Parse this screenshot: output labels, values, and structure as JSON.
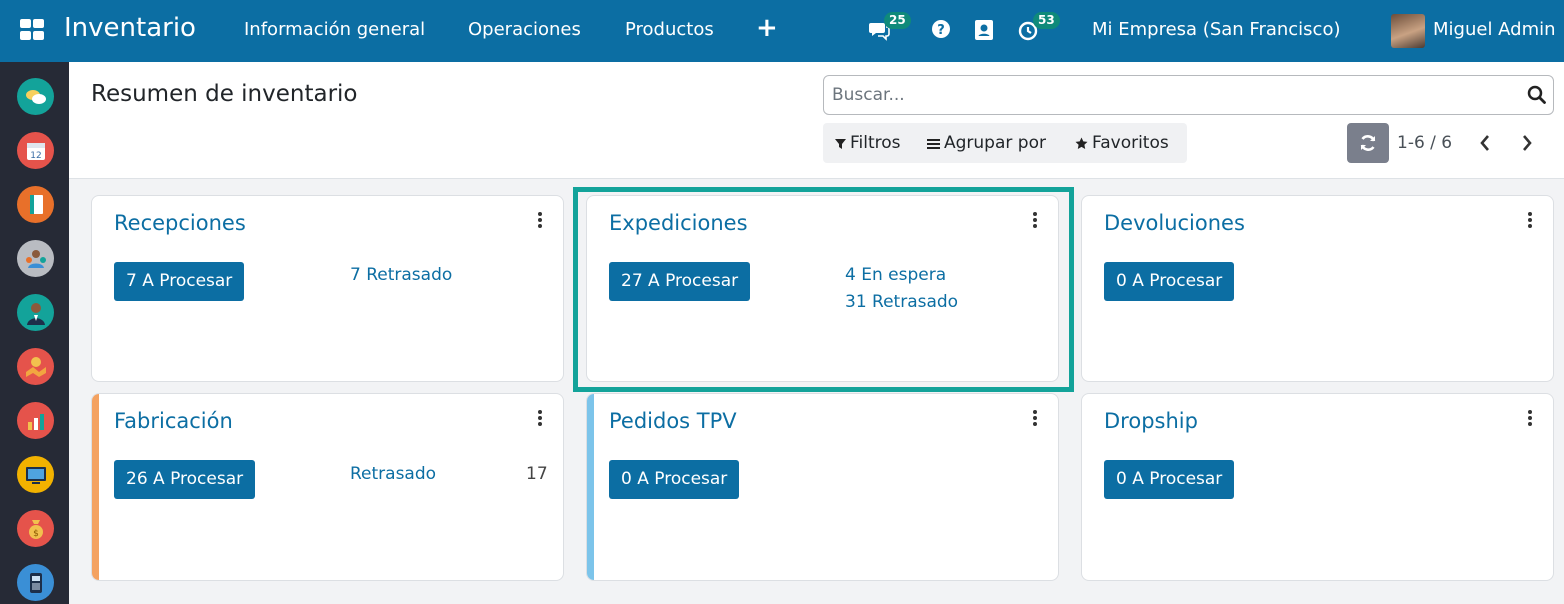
{
  "topbar": {
    "app_name": "Inventario",
    "menu": [
      "Información general",
      "Operaciones",
      "Productos"
    ],
    "new_menu_icon": "plus-icon",
    "messages_count": "25",
    "activities_count": "53",
    "company": "Mi Empresa (San Francisco)",
    "user": "Miguel Admin",
    "brand_color": "#0c6ea3"
  },
  "sidebar": {
    "apps": [
      {
        "icon": "discuss-app-icon",
        "color": "#13a39a"
      },
      {
        "icon": "calendar-app-icon",
        "color": "#e5534b"
      },
      {
        "icon": "notes-app-icon",
        "color": "#e8702a"
      },
      {
        "icon": "contacts-app-icon",
        "color": "#8e8e93"
      },
      {
        "icon": "employees-app-icon",
        "color": "#13a39a"
      },
      {
        "icon": "crm-app-icon",
        "color": "#e5534b"
      },
      {
        "icon": "sales-app-icon",
        "color": "#e5534b"
      },
      {
        "icon": "website-app-icon",
        "color": "#f2b200"
      },
      {
        "icon": "invoicing-app-icon",
        "color": "#e5534b"
      },
      {
        "icon": "pos-app-icon",
        "color": "#3a8fd6"
      }
    ]
  },
  "control_panel": {
    "title": "Resumen de inventario",
    "search_placeholder": "Buscar...",
    "filters_label": "Filtros",
    "group_by_label": "Agrupar por",
    "favorites_label": "Favoritos",
    "pager": "1-6 / 6"
  },
  "cards": [
    {
      "title": "Recepciones",
      "button": "7 A Procesar",
      "links": [
        "7 Retrasado"
      ],
      "count": ""
    },
    {
      "title": "Expediciones",
      "button": "27 A Procesar",
      "links": [
        "4 En espera",
        "31 Retrasado"
      ],
      "count": ""
    },
    {
      "title": "Devoluciones",
      "button": "0 A Procesar",
      "links": [],
      "count": ""
    },
    {
      "title": "Fabricación",
      "button": "26 A Procesar",
      "links": [
        "Retrasado"
      ],
      "count": "17",
      "stripe_color": "#f4a261"
    },
    {
      "title": "Pedidos TPV",
      "button": "0 A Procesar",
      "links": [],
      "count": "",
      "stripe_color": "#7cc4ea"
    },
    {
      "title": "Dropship",
      "button": "0 A Procesar",
      "links": [],
      "count": ""
    }
  ],
  "highlight_color": "#13a39a"
}
